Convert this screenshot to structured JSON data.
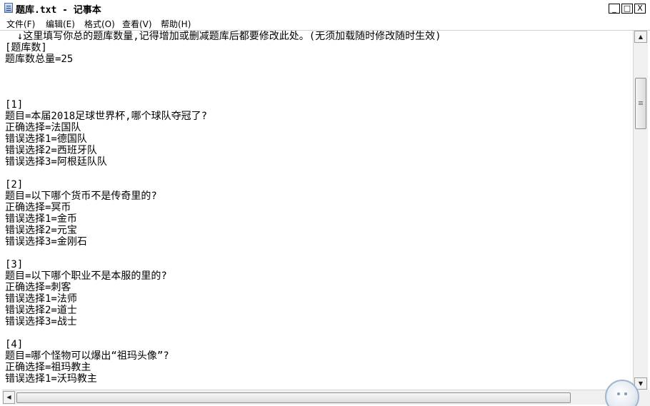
{
  "window": {
    "title": "题库.txt - 记事本",
    "controls": {
      "minimize": "_",
      "maximize": "□",
      "close": "X"
    }
  },
  "menu": [
    {
      "label": "文件(F)"
    },
    {
      "label": "编辑(E)"
    },
    {
      "label": "格式(O)"
    },
    {
      "label": "查看(V)"
    },
    {
      "label": "帮助(H)"
    }
  ],
  "editor": {
    "lines": [
      "  ↓这里填写你总的题库数量,记得增加或删减题库后都要修改此处。(无须加载随时修改随时生效)",
      "[题库数]",
      "题库数总量=25",
      "",
      "",
      "",
      "[1]",
      "题目=本届2018足球世界杯,哪个球队夺冠了?",
      "正确选择=法国队",
      "错误选择1=德国队",
      "错误选择2=西班牙队",
      "错误选择3=阿根廷队队",
      "",
      "[2]",
      "题目=以下哪个货币不是传奇里的?",
      "正确选择=冥币",
      "错误选择1=金币",
      "错误选择2=元宝",
      "错误选择3=金刚石",
      "",
      "[3]",
      "题目=以下哪个职业不是本服的里的?",
      "正确选择=刺客",
      "错误选择1=法师",
      "错误选择2=道士",
      "错误选择3=战士",
      "",
      "[4]",
      "题目=哪个怪物可以爆出“祖玛头像”?",
      "正确选择=祖玛教主",
      "错误选择1=沃玛教主"
    ]
  },
  "scrollbars": {
    "vertical_up": "▲",
    "vertical_down": "▼",
    "horizontal_left": "◀",
    "horizontal_right": "▶"
  }
}
